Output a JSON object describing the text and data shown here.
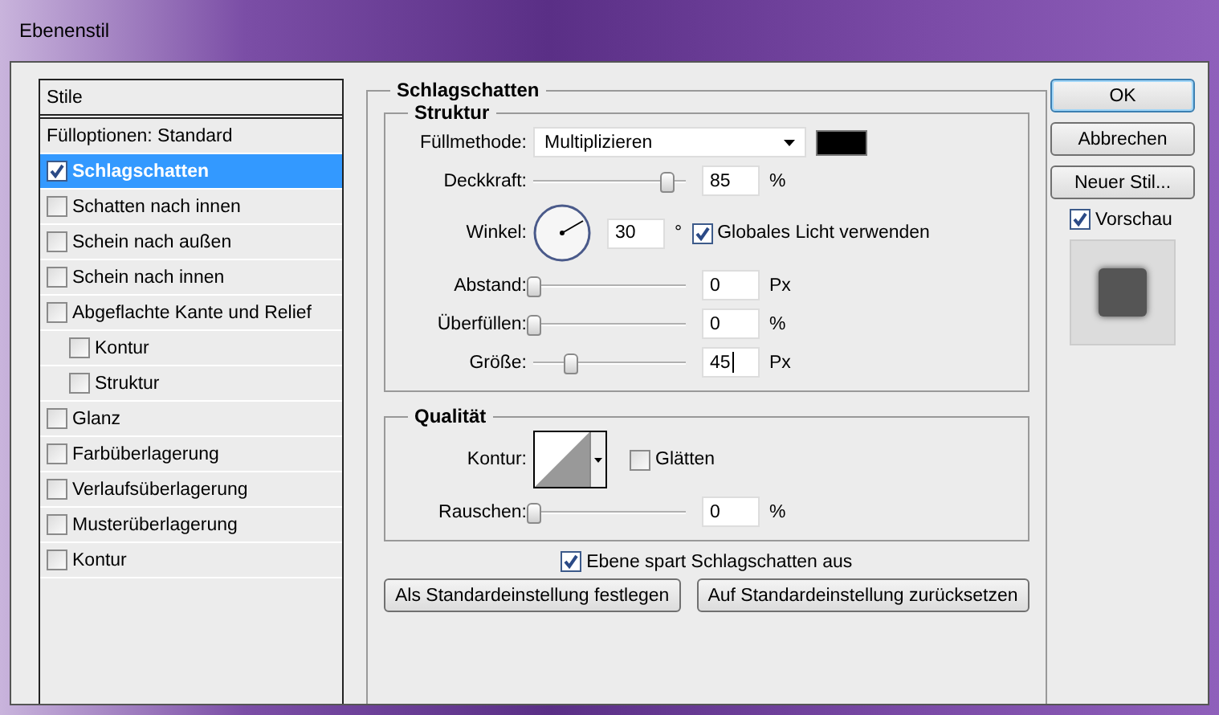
{
  "window": {
    "title": "Ebenenstil"
  },
  "styles": {
    "header": "Stile",
    "items": [
      {
        "label": "Fülloptionen: Standard",
        "kind": "plain",
        "selected": false
      },
      {
        "label": "Schlagschatten",
        "kind": "check",
        "checked": true,
        "selected": true
      },
      {
        "label": "Schatten nach innen",
        "kind": "check",
        "checked": false,
        "selected": false
      },
      {
        "label": "Schein nach außen",
        "kind": "check",
        "checked": false,
        "selected": false
      },
      {
        "label": "Schein nach innen",
        "kind": "check",
        "checked": false,
        "selected": false
      },
      {
        "label": "Abgeflachte Kante und Relief",
        "kind": "check",
        "checked": false,
        "selected": false,
        "children": [
          {
            "label": "Kontur",
            "kind": "check",
            "checked": false,
            "selected": false
          },
          {
            "label": "Struktur",
            "kind": "check",
            "checked": false,
            "selected": false
          }
        ]
      },
      {
        "label": "Glanz",
        "kind": "check",
        "checked": false,
        "selected": false
      },
      {
        "label": "Farbüberlagerung",
        "kind": "check",
        "checked": false,
        "selected": false
      },
      {
        "label": "Verlaufsüberlagerung",
        "kind": "check",
        "checked": false,
        "selected": false
      },
      {
        "label": "Musterüberlagerung",
        "kind": "check",
        "checked": false,
        "selected": false
      },
      {
        "label": "Kontur",
        "kind": "check",
        "checked": false,
        "selected": false
      }
    ]
  },
  "drop_shadow": {
    "title": "Schlagschatten",
    "structure": {
      "title": "Struktur",
      "blend_mode": {
        "label": "Füllmethode:",
        "value": "Multiplizieren"
      },
      "opacity": {
        "label": "Deckkraft:",
        "level": 0.87,
        "value": "85",
        "unit": "%",
        "focused": false
      },
      "angle": {
        "label": "Winkel:",
        "value": "30",
        "unit": "°",
        "global_light": {
          "label": "Globales Licht verwenden",
          "checked": true
        }
      },
      "distance": {
        "label": "Abstand:",
        "level": 0,
        "value": "0",
        "unit": "Px",
        "focused": false
      },
      "spread": {
        "label": "Überfüllen:",
        "level": 0,
        "value": "0",
        "unit": "%",
        "focused": false
      },
      "size": {
        "label": "Größe:",
        "level": 0.24,
        "value": "45",
        "unit": "Px",
        "focused": true
      }
    },
    "quality": {
      "title": "Qualität",
      "contour": {
        "label": "Kontur:"
      },
      "anti_alias": {
        "label": "Glätten",
        "checked": false
      },
      "noise": {
        "label": "Rauschen:",
        "level": 0,
        "value": "0",
        "unit": "%",
        "focused": false
      }
    },
    "knockout": {
      "label": "Ebene spart Schlagschatten aus",
      "checked": true
    },
    "buttons": [
      "Als Standardeinstellung festlegen",
      "Auf Standardeinstellung zurücksetzen"
    ]
  },
  "side_buttons": [
    {
      "label": "OK",
      "default": true
    },
    {
      "label": "Abbrechen",
      "default": false
    },
    {
      "label": "Neuer Stil...",
      "default": false
    }
  ],
  "preview": {
    "label": "Vorschau",
    "checked": true
  }
}
